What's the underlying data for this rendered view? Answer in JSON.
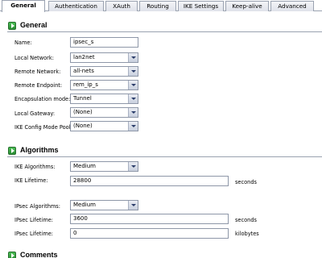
{
  "tabs": [
    "General",
    "Authentication",
    "XAuth",
    "Routing",
    "IKE Settings",
    "Keep-alive",
    "Advanced"
  ],
  "general": {
    "title": "General",
    "name_label": "Name:",
    "name_value": "ipsec_s",
    "local_network_label": "Local Network:",
    "local_network_value": "lan2net",
    "remote_network_label": "Remote Network:",
    "remote_network_value": "all-nets",
    "remote_endpoint_label": "Remote Endpoint:",
    "remote_endpoint_value": "rem_ip_s",
    "encapsulation_label": "Encapsulation mode:",
    "encapsulation_value": "Tunnel",
    "local_gateway_label": "Local Gateway:",
    "local_gateway_value": "(None)",
    "ike_config_label": "IKE Config Mode Pool:",
    "ike_config_value": "(None)"
  },
  "algorithms": {
    "title": "Algorithms",
    "ike_alg_label": "IKE Algorithms:",
    "ike_alg_value": "Medium",
    "ike_lifetime_label": "IKE Lifetime:",
    "ike_lifetime_value": "28800",
    "ike_lifetime_unit": "seconds",
    "ipsec_alg_label": "IPsec Algorithms:",
    "ipsec_alg_value": "Medium",
    "ipsec_lifetime_label": "IPsec Lifetime:",
    "ipsec_lifetime_value": "3600",
    "ipsec_lifetime_unit": "seconds",
    "ipsec_lifetime_kb_label": "IPsec Lifetime:",
    "ipsec_lifetime_kb_value": "0",
    "ipsec_lifetime_kb_unit": "kilobytes"
  },
  "comments": {
    "title": "Comments"
  }
}
